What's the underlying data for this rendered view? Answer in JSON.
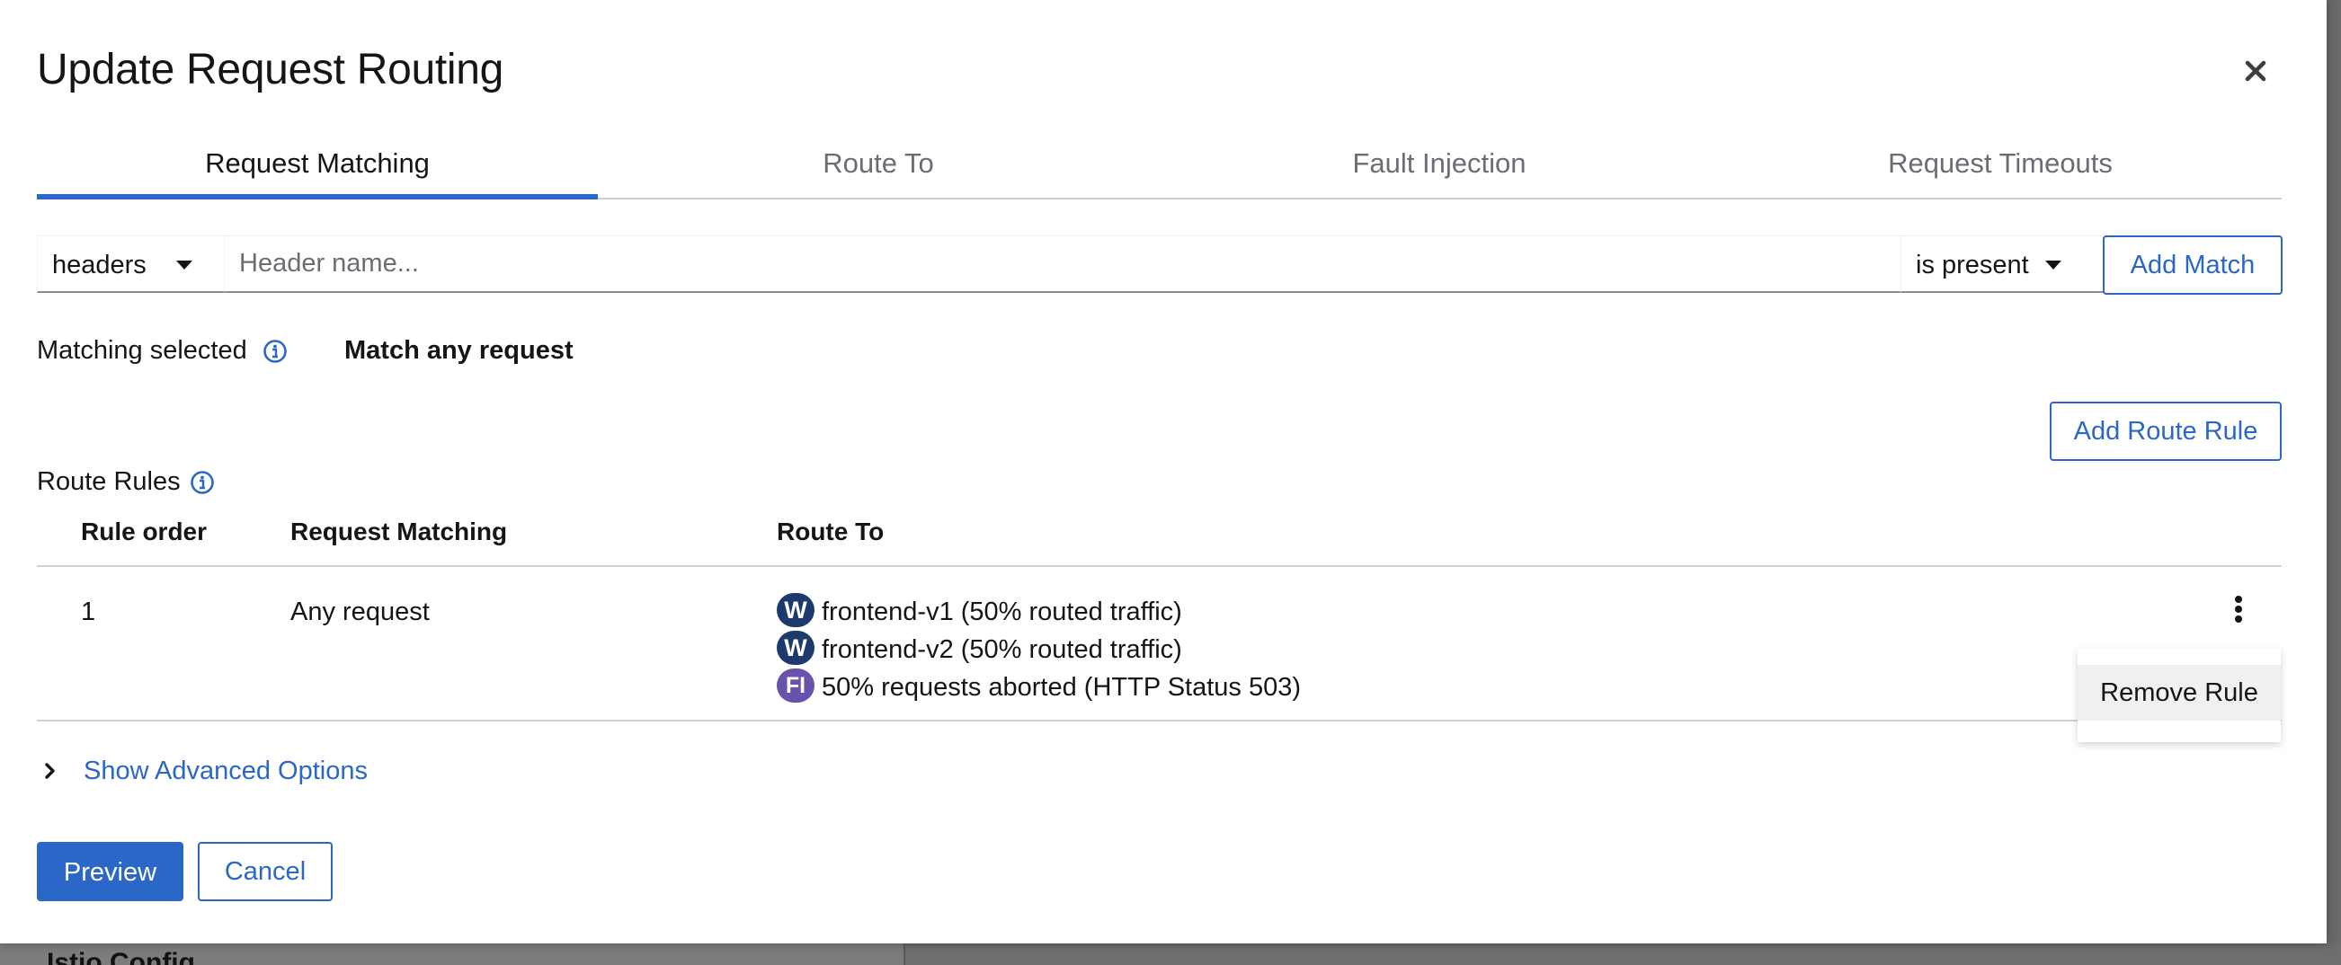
{
  "modal": {
    "title": "Update Request Routing"
  },
  "tabs": [
    {
      "label": "Request Matching",
      "active": true
    },
    {
      "label": "Route To",
      "active": false
    },
    {
      "label": "Fault Injection",
      "active": false
    },
    {
      "label": "Request Timeouts",
      "active": false
    }
  ],
  "match_row": {
    "field_type_value": "headers",
    "header_name_placeholder": "Header name...",
    "header_name_value": "",
    "operator_value": "is present",
    "add_match_label": "Add Match"
  },
  "matching": {
    "label": "Matching selected",
    "value": "Match any request"
  },
  "route_rules": {
    "add_label": "Add Route Rule",
    "label": "Route Rules",
    "columns": [
      "Rule order",
      "Request Matching",
      "Route To"
    ],
    "rows": [
      {
        "order": "1",
        "matching": "Any request",
        "routes": [
          {
            "badge": "W",
            "text": "frontend-v1 (50% routed traffic)"
          },
          {
            "badge": "W",
            "text": "frontend-v2 (50% routed traffic)"
          },
          {
            "badge": "FI",
            "text": "50% requests aborted (HTTP Status 503)"
          }
        ]
      }
    ]
  },
  "row_menu": {
    "remove_label": "Remove Rule"
  },
  "advanced": {
    "label": "Show Advanced Options"
  },
  "footer": {
    "preview_label": "Preview",
    "cancel_label": "Cancel"
  },
  "background": {
    "panel_title": "Istio Config"
  },
  "colors": {
    "accent": "#2b67c6",
    "workload_badge": "#1d3a6d",
    "fault_badge": "#6753ac",
    "info_icon": "#2b67c6"
  }
}
